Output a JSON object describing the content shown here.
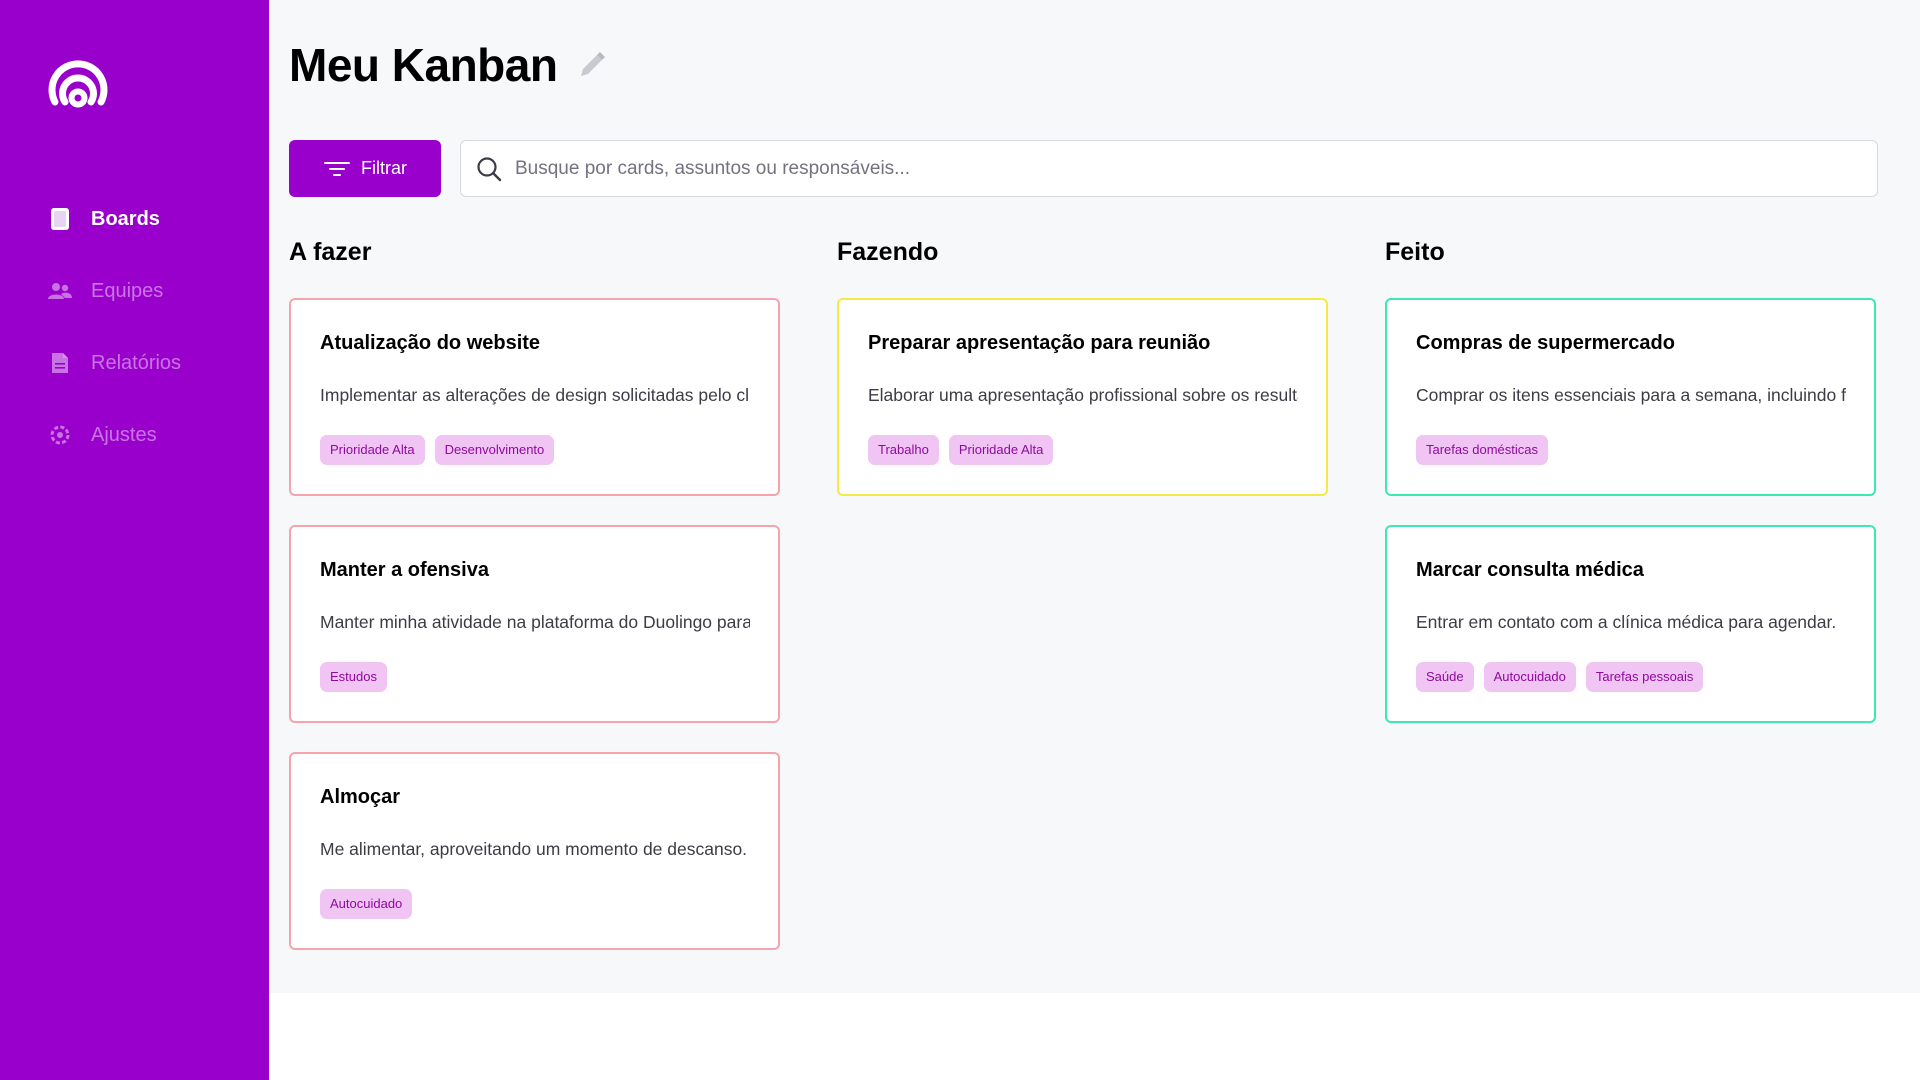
{
  "colors": {
    "brand": "#9a00cc",
    "todo_border": "#f7a3ad",
    "doing_border": "#f5e948",
    "done_border": "#3de8b1",
    "tag_bg": "#f0c4f3",
    "tag_text": "#8e0a9e"
  },
  "sidebar": {
    "logo_icon": "signal-logo-icon",
    "items": [
      {
        "label": "Boards",
        "icon": "board-icon",
        "active": true
      },
      {
        "label": "Equipes",
        "icon": "users-icon",
        "active": false
      },
      {
        "label": "Relatórios",
        "icon": "document-icon",
        "active": false
      },
      {
        "label": "Ajustes",
        "icon": "settings-icon",
        "active": false
      }
    ]
  },
  "header": {
    "title": "Meu Kanban",
    "edit_icon": "pencil-icon"
  },
  "toolbar": {
    "filter_label": "Filtrar",
    "filter_icon": "filter-icon",
    "search_placeholder": "Busque por cards, assuntos ou responsáveis...",
    "search_value": "",
    "search_icon": "search-icon"
  },
  "columns": [
    {
      "title": "A fazer",
      "cards": [
        {
          "title": "Atualização do website",
          "description": "Implementar as alterações de design solicitadas pelo cliente no website.",
          "tags": [
            "Prioridade Alta",
            "Desenvolvimento"
          ]
        },
        {
          "title": "Manter a ofensiva",
          "description": "Manter minha atividade na plataforma do Duolingo para não perder a ofensiva.",
          "tags": [
            "Estudos"
          ]
        },
        {
          "title": "Almoçar",
          "description": "Me alimentar, aproveitando um momento de descanso.",
          "tags": [
            "Autocuidado"
          ]
        }
      ]
    },
    {
      "title": "Fazendo",
      "cards": [
        {
          "title": "Preparar apresentação para reunião",
          "description": "Elaborar uma apresentação profissional sobre os resultados.",
          "tags": [
            "Trabalho",
            "Prioridade Alta"
          ]
        }
      ]
    },
    {
      "title": "Feito",
      "cards": [
        {
          "title": "Compras de supermercado",
          "description": "Comprar os itens essenciais para a semana, incluindo frutas.",
          "tags": [
            "Tarefas domésticas"
          ]
        },
        {
          "title": "Marcar consulta médica",
          "description": "Entrar em contato com a clínica médica para agendar.",
          "tags": [
            "Saúde",
            "Autocuidado",
            "Tarefas pessoais"
          ]
        }
      ]
    }
  ]
}
